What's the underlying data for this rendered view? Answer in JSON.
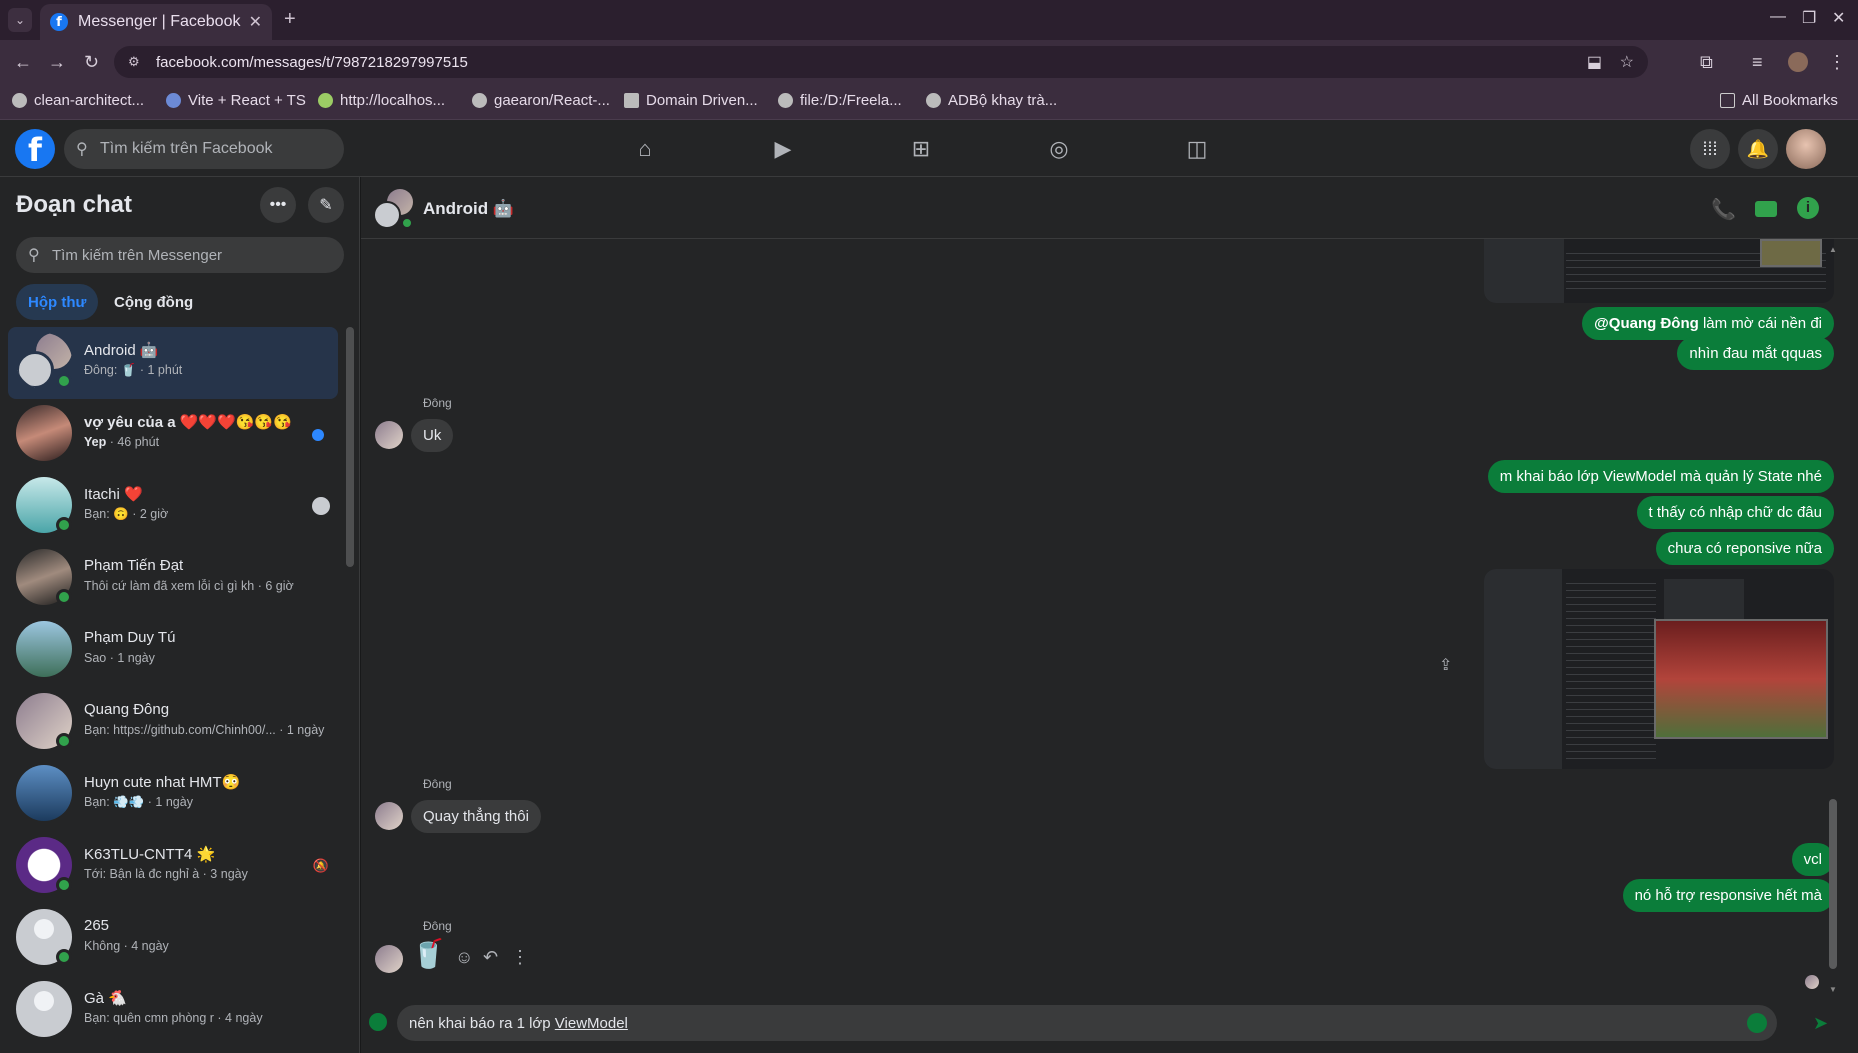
{
  "browser": {
    "tab_title": "Messenger | Facebook",
    "url": "facebook.com/messages/t/7987218297997515",
    "bookmarks": [
      "clean-architect...",
      "Vite + React + TS",
      "http://localhos...",
      "gaearon/React-...",
      "Domain Driven...",
      "file:/D:/Freela...",
      "ADBộ khay trà..."
    ],
    "all_bookmarks": "All Bookmarks"
  },
  "facebook": {
    "search_placeholder": "Tìm kiếm trên Facebook"
  },
  "sidebar": {
    "title": "Đoạn chat",
    "search_placeholder": "Tìm kiếm trên Messenger",
    "tabs": [
      "Hộp thư",
      "Cộng đồng"
    ],
    "conversations": [
      {
        "name": "Android 🤖",
        "preview": "Đông: 🥤 · 1 phút"
      },
      {
        "name": "vợ yêu của a ❤️❤️❤️😘😘😘",
        "preview_bold": "Yep",
        "preview": " · 46 phút"
      },
      {
        "name": "Itachi ❤️",
        "preview": "Bạn: 🙃 · 2 giờ"
      },
      {
        "name": "Phạm Tiến Đạt",
        "preview": "Thôi cứ làm đã xem lỗi cì gì kh · 6 giờ"
      },
      {
        "name": "Phạm Duy Tú",
        "preview": "Sao · 1 ngày"
      },
      {
        "name": "Quang Đông",
        "preview": "Bạn: https://github.com/Chinh00/... · 1 ngày"
      },
      {
        "name": "Huyn cute nhat HMT😳",
        "preview": "Bạn: 💨💨 · 1 ngày"
      },
      {
        "name": "K63TLU-CNTT4 🌟",
        "preview": "Tới: Bận là đc nghỉ à · 3 ngày"
      },
      {
        "name": "265",
        "preview": "Không · 4 ngày"
      },
      {
        "name": "Gà 🐔",
        "preview": "Bạn: quên cmn phòng r · 4 ngày"
      }
    ]
  },
  "chat": {
    "title": "Android 🤖",
    "messages": {
      "out1_mention": "@Quang Đông",
      "out1_rest": " làm mờ cái nền đi",
      "out2": "nhìn đau mắt qquas",
      "sender1": "Đông",
      "in1": "Uk",
      "out3": "m khai báo lớp ViewModel mà quản lý State nhé",
      "out4": "t thấy có nhập chữ dc đâu",
      "out5": "chưa có reponsive nữa",
      "sender2": "Đông",
      "in2": "Quay thẳng thôi",
      "out6": "vcl",
      "out7": "nó hỗ trợ responsive hết mà",
      "sender3": "Đông",
      "in3_sticker": "🥤"
    },
    "composer_text": "nên khai báo ra 1 lớp ",
    "composer_link": "ViewModel"
  }
}
